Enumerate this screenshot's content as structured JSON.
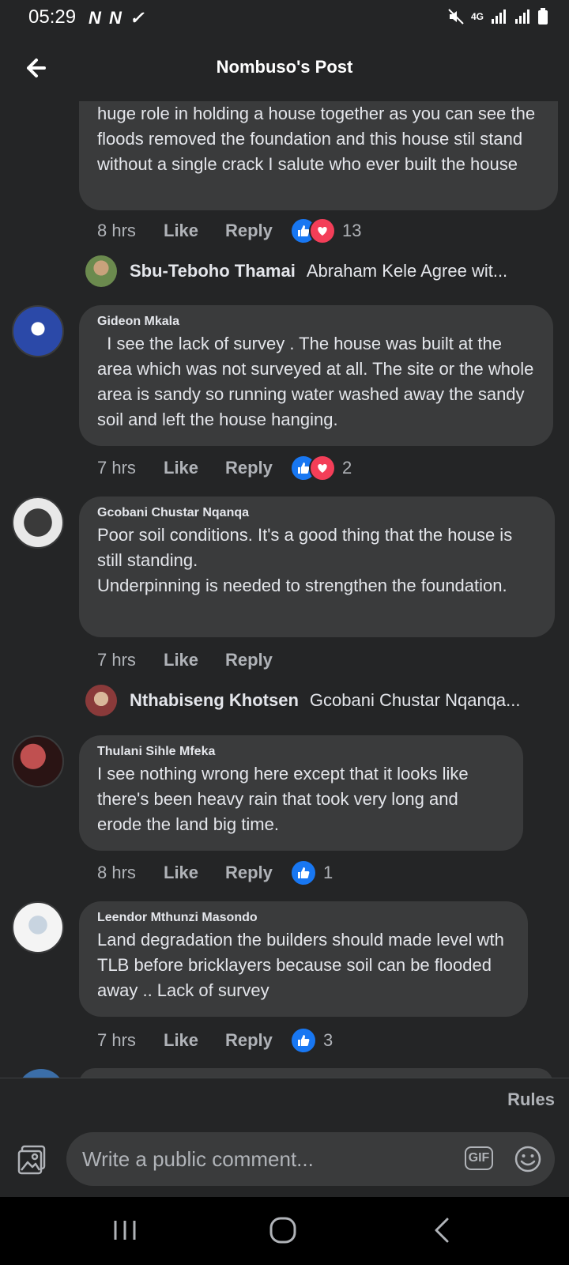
{
  "status_bar": {
    "time": "05:29",
    "left_icons": "N N ✓",
    "network": "4G"
  },
  "header": {
    "title": "Nombuso's Post"
  },
  "comments": [
    {
      "author": "",
      "text": "huge role in holding a house together as you can see the floods removed the foundation and this house stil stand without a single crack I salute who ever built the house",
      "time": "8 hrs",
      "like": "Like",
      "reply": "Reply",
      "reaction_count": "13",
      "reactions": [
        "like-icon",
        "love-icon"
      ]
    },
    {
      "author": "Gideon Mkala",
      "text": "  I see the lack of survey . The house was built at the area which was not surveyed at all. The site or the whole area is sandy so running water washed away the sandy soil and left the house hanging.",
      "time": "7 hrs",
      "like": "Like",
      "reply": "Reply",
      "reaction_count": "2",
      "reactions": [
        "like-icon",
        "love-icon"
      ]
    },
    {
      "author": "Gcobani Chustar Nqanqa",
      "text": "Poor soil conditions. It's a good thing that the house is still standing.\nUnderpinning is needed to strengthen the foundation.",
      "time": "7 hrs",
      "like": "Like",
      "reply": "Reply"
    },
    {
      "author": "Thulani Sihle Mfeka",
      "text": "I see nothing wrong here except that it looks like there's been heavy rain that took very long and erode the land big time.",
      "time": "8 hrs",
      "like": "Like",
      "reply": "Reply",
      "reaction_count": "1",
      "reactions": [
        "like-icon"
      ]
    },
    {
      "author": "Leendor Mthunzi Masondo",
      "text": "Land degradation the builders should made level wth TLB before bricklayers because soil can be flooded away .. Lack of survey",
      "time": "7 hrs",
      "like": "Like",
      "reply": "Reply",
      "reaction_count": "3",
      "reactions": [
        "like-icon"
      ]
    }
  ],
  "reply_previews": [
    {
      "name": "Sbu-Teboho Thamai",
      "text": "Abraham Kele Agree wit..."
    },
    {
      "name": "Nthabiseng Khotsen",
      "text": "Gcobani Chustar Nqanqa..."
    }
  ],
  "composer": {
    "rules": "Rules",
    "placeholder": "Write a public comment...",
    "gif": "GIF"
  },
  "colors": {
    "background": "#242526",
    "bubble": "#3a3b3c",
    "like_blue": "#1877f2",
    "love_red": "#f33e58"
  }
}
